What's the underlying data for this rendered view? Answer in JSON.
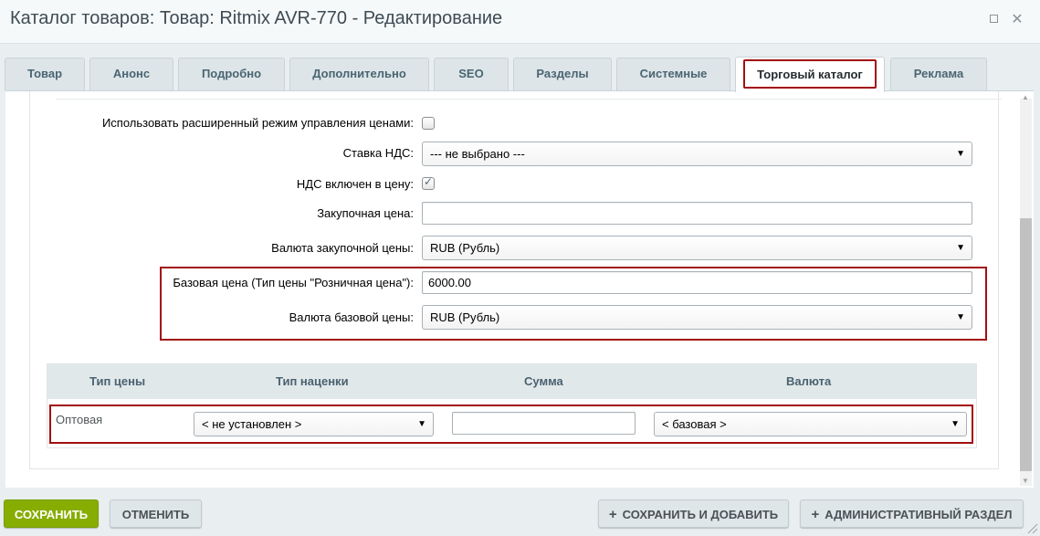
{
  "window": {
    "title": "Каталог товаров: Товар: Ritmix AVR-770 - Редактирование",
    "maximize_icon": "maximize-icon",
    "close_icon": "close-icon",
    "close_glyph": "✕"
  },
  "tabs": [
    {
      "label": "Товар"
    },
    {
      "label": "Анонс"
    },
    {
      "label": "Подробно"
    },
    {
      "label": "Дополнительно"
    },
    {
      "label": "SEO"
    },
    {
      "label": "Разделы"
    },
    {
      "label": "Системные"
    },
    {
      "label": "Торговый каталог",
      "active": true
    },
    {
      "label": "Реклама"
    }
  ],
  "form": {
    "extended_price_mode": {
      "label": "Использовать расширенный режим управления ценами:",
      "checked": false
    },
    "vat_rate": {
      "label": "Ставка НДС:",
      "value": "--- не выбрано ---"
    },
    "vat_included": {
      "label": "НДС включен в цену:",
      "checked": true,
      "check_glyph": "✓"
    },
    "purchase_price": {
      "label": "Закупочная цена:",
      "value": ""
    },
    "purchase_currency": {
      "label": "Валюта закупочной цены:",
      "value": "RUB (Рубль)"
    },
    "base_price": {
      "label": "Базовая цена (Тип цены \"Розничная цена\"):",
      "value": "6000.00"
    },
    "base_currency": {
      "label": "Валюта базовой цены:",
      "value": "RUB (Рубль)"
    }
  },
  "price_table": {
    "headers": [
      "Тип цены",
      "Тип наценки",
      "Сумма",
      "Валюта"
    ],
    "rows": [
      {
        "price_type": "Оптовая",
        "markup_type": "< не установлен >",
        "amount": "",
        "currency": "< базовая >"
      }
    ]
  },
  "select_arrow_glyph": "▼",
  "buttons": {
    "save": "СОХРАНИТЬ",
    "cancel": "ОТМЕНИТЬ",
    "save_and_add": "СОХРАНИТЬ И ДОБАВИТЬ",
    "admin_section": "АДМИНИСТРАТИВНЫЙ РАЗДЕЛ",
    "plus_glyph": "+"
  },
  "colors": {
    "highlight_red": "#a20f10",
    "save_green": "#86ad00",
    "tab_text": "#4a6572"
  }
}
